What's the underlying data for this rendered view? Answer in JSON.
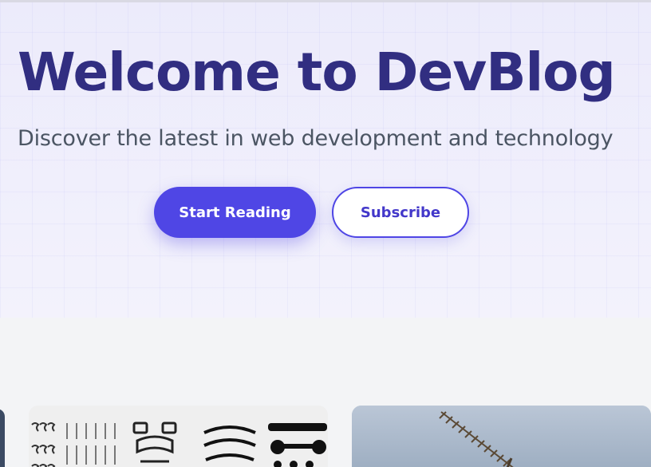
{
  "hero": {
    "title": "Welcome to DevBlog",
    "subtitle": "Discover the latest in web development and technology",
    "primary_button": "Start Reading",
    "secondary_button": "Subscribe"
  },
  "colors": {
    "title": "#312e81",
    "accent": "#4f46e5",
    "subtitle": "#4b5563",
    "hero_bg": "#eeeefc",
    "page_bg": "#f3f4f6"
  },
  "cards": [
    {
      "image": "mechanical-parts-flatlay"
    },
    {
      "image": "antenna-against-sky"
    }
  ]
}
